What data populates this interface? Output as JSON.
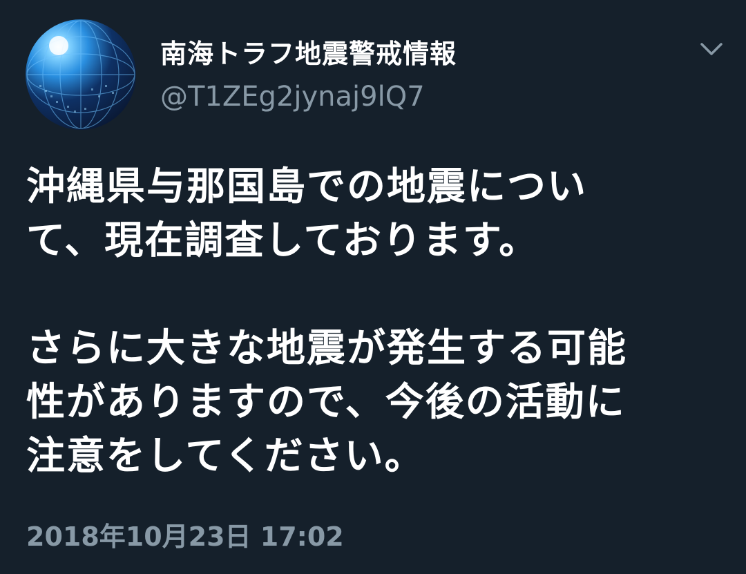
{
  "tweet": {
    "display_name": "南海トラフ地震警戒情報",
    "handle": "@T1ZEg2jynaj9lQ7",
    "text_lines": [
      "沖縄県与那国島での地震につい",
      "て、現在調査しております。",
      "さらに大きな地震が発生する可能",
      "性がありますので、今後の活動に",
      "注意をしてください。"
    ],
    "timestamp": "2018年10月23日 17:02"
  },
  "icons": {
    "menu": "chevron-down-icon",
    "avatar": "globe-avatar"
  },
  "colors": {
    "background": "#15202b",
    "primary_text": "#ffffff",
    "secondary_text": "#8899a6"
  }
}
